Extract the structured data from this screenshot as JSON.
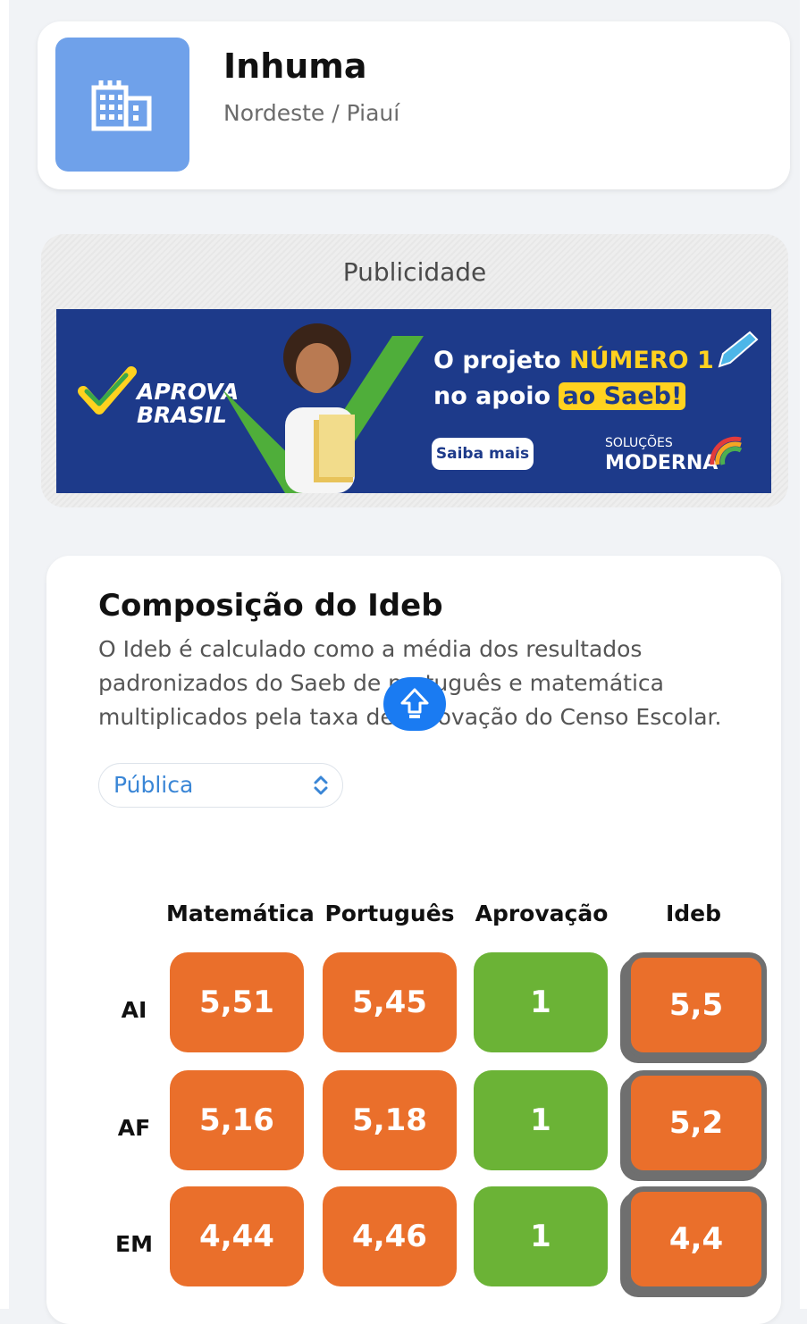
{
  "city": {
    "name": "Inhuma",
    "region": "Nordeste / Piauí",
    "icon": "city-buildings-icon",
    "icon_bg_color": "#6fa1ea"
  },
  "ad": {
    "label": "Publicidade",
    "brand_left_line1": "APROVA",
    "brand_left_line2": "BRASIL",
    "headline_part1": "O projeto ",
    "headline_highlight": "NÚMERO 1",
    "headline_part2": "no apoio ",
    "headline_badge": "ao Saeb!",
    "cta": "Saiba mais",
    "brand_right_small": "SOLUÇÕES",
    "brand_right": "MODERNA",
    "bg_color": "#1d3a8a",
    "accent_color": "#ffd21f"
  },
  "ideb": {
    "title": "Composição do Ideb",
    "description": "O Ideb é calculado como a média dos resultados padronizados do Saeb de português e matemática multiplicados pela taxa de aprovação do Censo Escolar.",
    "network_select": {
      "selected": "Pública",
      "icon": "updown-chevron-icon"
    },
    "columns": [
      "Matemática",
      "Português",
      "Aprovação",
      "Ideb"
    ],
    "rows": [
      {
        "label": "AI",
        "values": [
          "5,51",
          "5,45",
          "1",
          "5,5"
        ]
      },
      {
        "label": "AF",
        "values": [
          "5,16",
          "5,18",
          "1",
          "5,2"
        ]
      },
      {
        "label": "EM",
        "values": [
          "4,44",
          "4,46",
          "1",
          "4,4"
        ]
      }
    ],
    "colors": {
      "score": "#ea6f2b",
      "approval": "#6bb336",
      "ideb_border": "#6f6f6f"
    }
  },
  "scroll_top_button": {
    "icon": "arrow-up-icon",
    "color": "#1a7bf2"
  }
}
